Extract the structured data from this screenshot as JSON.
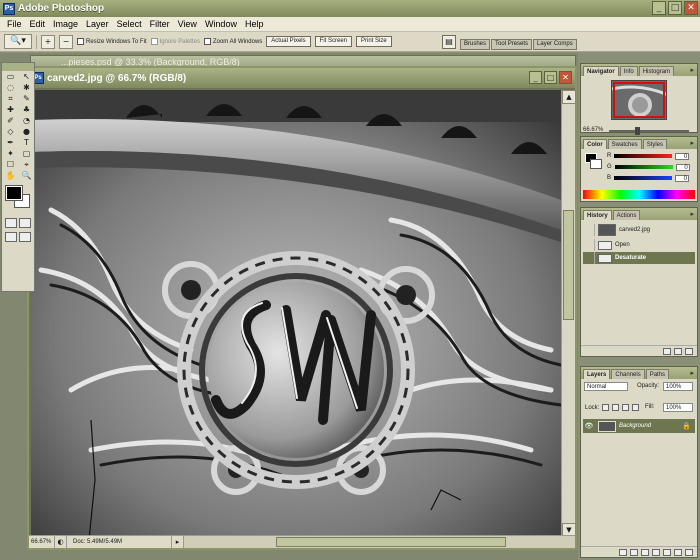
{
  "app": {
    "title": "Adobe Photoshop",
    "icon_text": "Ps",
    "window_buttons": [
      "_",
      "□",
      "✕"
    ]
  },
  "menu": [
    "File",
    "Edit",
    "Image",
    "Layer",
    "Select",
    "Filter",
    "View",
    "Window",
    "Help"
  ],
  "options_bar": {
    "tool_icon": "zoom-tool-icon",
    "tool_glyph": "🔍▾",
    "zoom_in_glyph": "+",
    "zoom_out_glyph": "−",
    "resize_windows_to_fit": "Resize Windows To Fit",
    "ignore_palettes": "Ignore Palettes",
    "zoom_all_windows": "Zoom All Windows",
    "actual_pixels": "Actual Pixels",
    "fit_screen": "Fit Screen",
    "print_size": "Print Size"
  },
  "palette_well": [
    "Brushes",
    "Tool Presets",
    "Layer Comps"
  ],
  "documents": {
    "back_title": "...pieses.psd @ 33.3% (Background, RGB/8)",
    "front_title": "carved2.jpg @ 66.7% (RGB/8)",
    "front_icon_text": "Ps",
    "zoom": "66.67%",
    "doc_size": "Doc: 5.49M/5.49M",
    "status_icon_glyph": "▸",
    "scroll_up_glyph": "▲",
    "scroll_down_glyph": "▼"
  },
  "navigator": {
    "tabs": [
      "Navigator",
      "Info",
      "Histogram"
    ],
    "zoom": "66.67%"
  },
  "color_panel": {
    "tabs": [
      "Color",
      "Swatches",
      "Styles"
    ],
    "channels": [
      {
        "label": "R",
        "value": "0",
        "color": "#d03030"
      },
      {
        "label": "G",
        "value": "0",
        "color": "#30a030"
      },
      {
        "label": "B",
        "value": "0",
        "color": "#3050c0"
      }
    ]
  },
  "history": {
    "tabs": [
      "History",
      "Actions"
    ],
    "items": [
      {
        "label": "carved2.jpg",
        "selected": false
      },
      {
        "label": "Open",
        "selected": false
      },
      {
        "label": "Desaturate",
        "selected": true
      }
    ]
  },
  "layers": {
    "tabs": [
      "Layers",
      "Channels",
      "Paths"
    ],
    "blend_mode": "Normal",
    "opacity_label": "Opacity:",
    "opacity": "100%",
    "lock_label": "Lock:",
    "fill_label": "Fill:",
    "fill": "100%",
    "items": [
      {
        "name": "Background",
        "visible": true,
        "locked": true
      }
    ]
  },
  "toolbox": {
    "tools": [
      "▭",
      "↖",
      "◌",
      "✱",
      "⌗",
      "✎",
      "✚",
      "♣",
      "✐",
      "◔",
      "◇",
      "●",
      "✒",
      "T",
      "✦",
      "▢",
      "☐",
      "⌖",
      "✋",
      "🔍"
    ]
  },
  "colors": {
    "accent": "#8c9468",
    "selected_row": "#6e7650"
  }
}
